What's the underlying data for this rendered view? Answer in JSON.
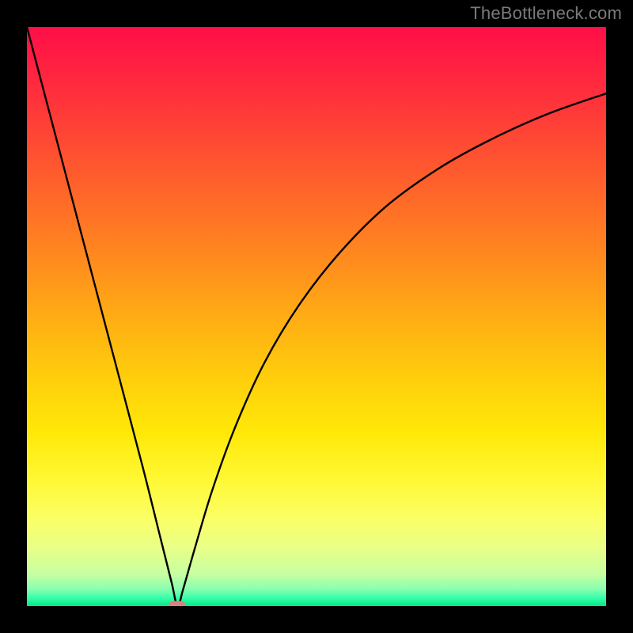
{
  "watermark": "TheBottleneck.com",
  "gradient": {
    "stops": [
      {
        "offset": 0.0,
        "color": "#ff0e48"
      },
      {
        "offset": 0.1,
        "color": "#ff2a3e"
      },
      {
        "offset": 0.2,
        "color": "#ff4a33"
      },
      {
        "offset": 0.3,
        "color": "#ff6a28"
      },
      {
        "offset": 0.4,
        "color": "#ff8a1e"
      },
      {
        "offset": 0.5,
        "color": "#ffac14"
      },
      {
        "offset": 0.6,
        "color": "#ffcc0c"
      },
      {
        "offset": 0.7,
        "color": "#ffe808"
      },
      {
        "offset": 0.78,
        "color": "#fff833"
      },
      {
        "offset": 0.85,
        "color": "#fbff66"
      },
      {
        "offset": 0.9,
        "color": "#e8ff88"
      },
      {
        "offset": 0.945,
        "color": "#c7ffa2"
      },
      {
        "offset": 0.97,
        "color": "#8affb0"
      },
      {
        "offset": 0.985,
        "color": "#3bffac"
      },
      {
        "offset": 1.0,
        "color": "#00e884"
      }
    ]
  },
  "chart_data": {
    "type": "line",
    "title": "",
    "xlabel": "",
    "ylabel": "",
    "xlim": [
      0,
      100
    ],
    "ylim": [
      0,
      100
    ],
    "x_minimum": 26,
    "series": [
      {
        "name": "curve",
        "color": "#000000",
        "points": [
          {
            "x": 0,
            "y": 100
          },
          {
            "x": 5,
            "y": 81
          },
          {
            "x": 10,
            "y": 62
          },
          {
            "x": 15,
            "y": 43
          },
          {
            "x": 20,
            "y": 24
          },
          {
            "x": 23,
            "y": 12
          },
          {
            "x": 25,
            "y": 4
          },
          {
            "x": 26,
            "y": 0
          },
          {
            "x": 27,
            "y": 3
          },
          {
            "x": 29,
            "y": 10
          },
          {
            "x": 32,
            "y": 20
          },
          {
            "x": 36,
            "y": 31
          },
          {
            "x": 41,
            "y": 42
          },
          {
            "x": 47,
            "y": 52
          },
          {
            "x": 54,
            "y": 61
          },
          {
            "x": 62,
            "y": 69
          },
          {
            "x": 71,
            "y": 75.5
          },
          {
            "x": 80,
            "y": 80.5
          },
          {
            "x": 90,
            "y": 85
          },
          {
            "x": 100,
            "y": 88.5
          }
        ]
      }
    ],
    "marker": {
      "x": 26,
      "y": 0,
      "color": "#d9817a"
    }
  }
}
